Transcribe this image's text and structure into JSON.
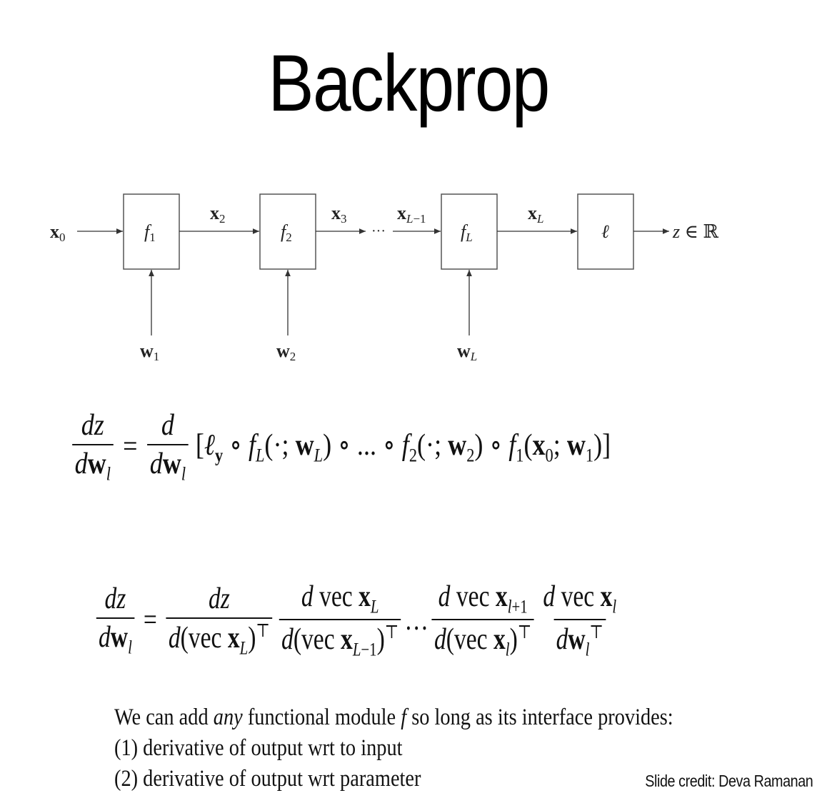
{
  "title": "Backprop",
  "diagram": {
    "input_label": "x0",
    "boxes": [
      "f1",
      "f2",
      "fL",
      "ℓ"
    ],
    "edge_labels": [
      "x2",
      "x3",
      "xL−1",
      "xL"
    ],
    "ellipsis": "···",
    "weights": [
      "w1",
      "w2",
      "wL"
    ],
    "output_label": "z ∈ ℝ"
  },
  "equation1": {
    "lhs_num": "dz",
    "lhs_den": "dw",
    "rhs_num": "d",
    "rhs_den": "dw",
    "expression": "[ℓy ∘ fL(·; wL) ∘ ... ∘ f2(·; w2) ∘ f1(x0; w1)]"
  },
  "equation2": {
    "lhs_num": "dz",
    "lhs_den": "dw",
    "terms": [
      {
        "num": "dz",
        "den": "d(vec xL)⊤"
      },
      {
        "num": "d vec xL",
        "den": "d(vec xL−1)⊤"
      },
      {
        "num": "d vec xl+1",
        "den": "d(vec xl)⊤"
      },
      {
        "num": "d vec xl",
        "den": "dwl⊤"
      }
    ],
    "dots": "…"
  },
  "text": {
    "line1_a": "We can add ",
    "line1_em": "any",
    "line1_b": " functional module ",
    "line1_f": "f",
    "line1_c": " so long as its interface provides:",
    "line2": "(1) derivative of output wrt to input",
    "line3": "(2) derivative of output wrt parameter"
  },
  "credit": "Slide credit: Deva Ramanan"
}
